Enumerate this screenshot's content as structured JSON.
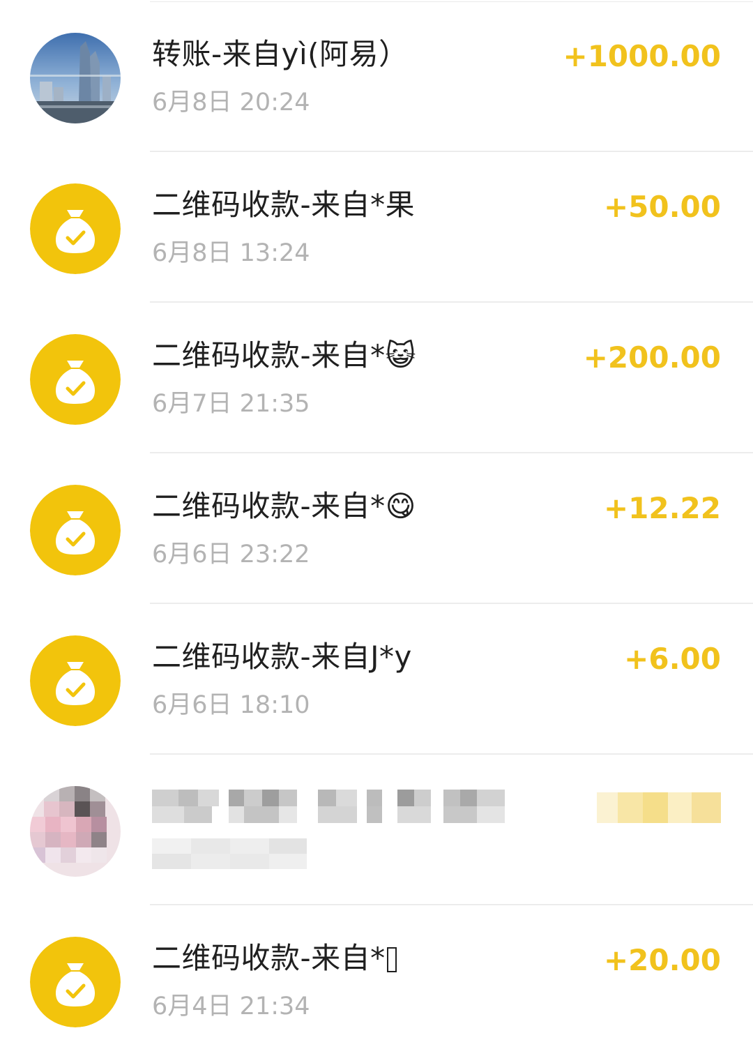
{
  "transactions": [
    {
      "avatar": "building-photo-avatar",
      "title": "转账-来自yì(阿易）",
      "time": "6月8日 20:24",
      "amount": "+1000.00"
    },
    {
      "avatar": "money-bag-icon",
      "title": "二维码收款-来自*果",
      "time": "6月8日 13:24",
      "amount": "+50.00"
    },
    {
      "avatar": "money-bag-icon",
      "title": "二维码收款-来自*😺",
      "time": "6月7日 21:35",
      "amount": "+200.00"
    },
    {
      "avatar": "money-bag-icon",
      "title": "二维码收款-来自*😋",
      "time": "6月6日 23:22",
      "amount": "+12.22"
    },
    {
      "avatar": "money-bag-icon",
      "title": "二维码收款-来自J*y",
      "time": "6月6日 18:10",
      "amount": "+6.00"
    },
    {
      "avatar": "pixelated-avatar",
      "title": "",
      "time": "",
      "amount": ""
    },
    {
      "avatar": "money-bag-icon",
      "title": "二维码收款-来自*",
      "time": "6月4日 21:34",
      "amount": "+20.00"
    }
  ],
  "colors": {
    "accent": "#f1c21d",
    "icon_circle": "#f2c40c",
    "title": "#1f1f1f",
    "time": "#b3b3b3",
    "divider": "#ececec"
  }
}
